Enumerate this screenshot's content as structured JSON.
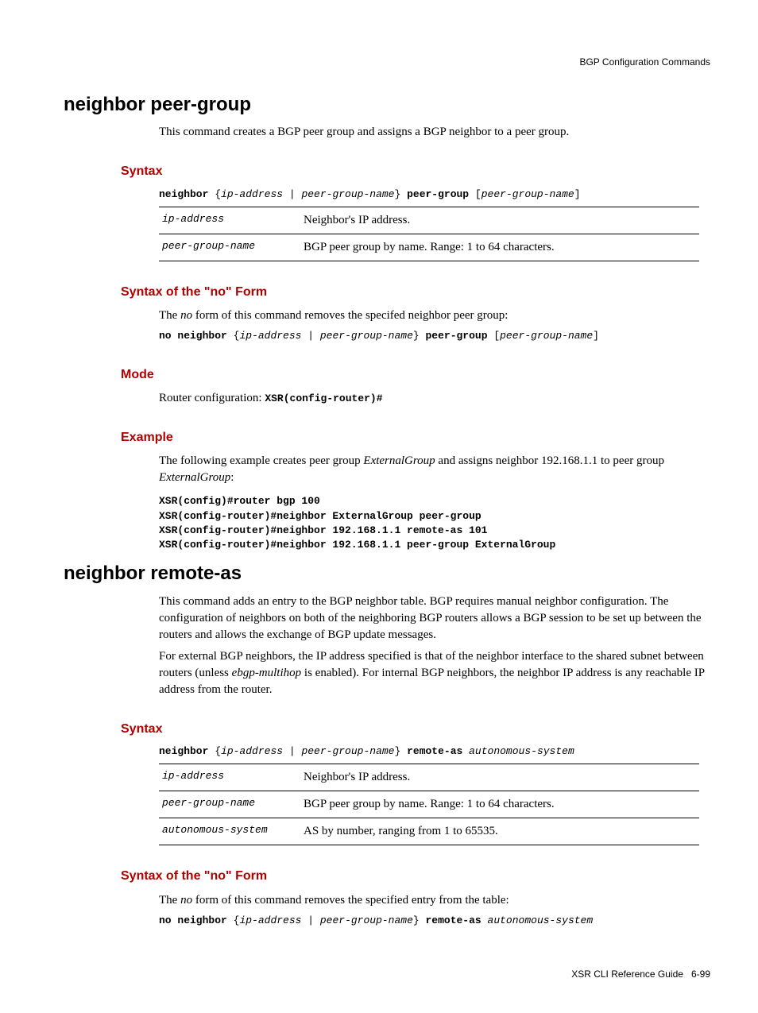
{
  "header": {
    "section": "BGP Configuration Commands"
  },
  "cmd1": {
    "title": "neighbor peer-group",
    "desc": "This command creates a BGP peer group and assigns a BGP neighbor to a peer group.",
    "syntax_heading": "Syntax",
    "syntax": {
      "kw1": "neighbor",
      "args1": " {",
      "ital1": "ip-address",
      "pipe": " | ",
      "ital2": "peer-group-name",
      "close1": "} ",
      "kw2": "peer-group",
      "open2": " [",
      "ital3": "peer-group-name",
      "close2": "]"
    },
    "params": [
      {
        "name": "ip-address",
        "desc": "Neighbor's IP address."
      },
      {
        "name": "peer-group-name",
        "desc": "BGP peer group by name. Range: 1 to 64 characters."
      }
    ],
    "noform_heading": "Syntax of the \"no\" Form",
    "noform_pre": "The ",
    "noform_italic": "no",
    "noform_post": " form of this command removes the specifed neighbor peer group:",
    "noform_syntax": {
      "kw1": "no neighbor",
      "args1": " {",
      "ital1": "ip-address",
      "pipe": " | ",
      "ital2": "peer-group-name",
      "close1": "} ",
      "kw2": "peer-group",
      "open2": " [",
      "ital3": "peer-group-name",
      "close2": "]"
    },
    "mode_heading": "Mode",
    "mode_pre": "Router configuration: ",
    "mode_code": "XSR(config-router)#",
    "example_heading": "Example",
    "example_pre1": "The following example creates peer group ",
    "example_ital1": "ExternalGroup",
    "example_mid": " and assigns neighbor 192.168.1.1 to peer group ",
    "example_ital2": "ExternalGroup",
    "example_post": ":",
    "example_code": "XSR(config)#router bgp 100\nXSR(config-router)#neighbor ExternalGroup peer-group\nXSR(config-router)#neighbor 192.168.1.1 remote-as 101\nXSR(config-router)#neighbor 192.168.1.1 peer-group ExternalGroup"
  },
  "cmd2": {
    "title": "neighbor remote-as",
    "desc1": "This command adds an entry to the BGP neighbor table. BGP requires manual neighbor configuration. The configuration of neighbors on both of the neighboring BGP routers allows a BGP session to be set up between the routers and allows the exchange of BGP update messages.",
    "desc2_pre": "For external BGP neighbors, the IP address specified is that of the neighbor interface to the shared subnet between routers (unless ",
    "desc2_ital": "ebgp-multihop",
    "desc2_post": " is enabled). For internal BGP neighbors, the neighbor IP address is any reachable IP address from the router.",
    "syntax_heading": "Syntax",
    "syntax": {
      "kw1": "neighbor",
      "args1": " {",
      "ital1": "ip-address",
      "pipe": " | ",
      "ital2": "peer-group-name",
      "close1": "} ",
      "kw2": "remote-as",
      "sp": " ",
      "ital3": "autonomous-system"
    },
    "params": [
      {
        "name": "ip-address",
        "desc": "Neighbor's IP address."
      },
      {
        "name": "peer-group-name",
        "desc": "BGP peer group by name. Range: 1 to 64 characters."
      },
      {
        "name": "autonomous-system",
        "desc": "AS by number, ranging from 1 to 65535."
      }
    ],
    "noform_heading": "Syntax of the \"no\" Form",
    "noform_pre": "The ",
    "noform_italic": "no",
    "noform_post": " form of this command removes the specified entry from the table:",
    "noform_syntax": {
      "kw1": "no neighbor",
      "args1": " {",
      "ital1": "ip-address",
      "pipe": " | ",
      "ital2": "peer-group-name",
      "close1": "} ",
      "kw2": "remote-as",
      "sp": " ",
      "ital3": "autonomous-system"
    }
  },
  "footer": {
    "book": "XSR CLI Reference Guide",
    "page": "6-99"
  }
}
